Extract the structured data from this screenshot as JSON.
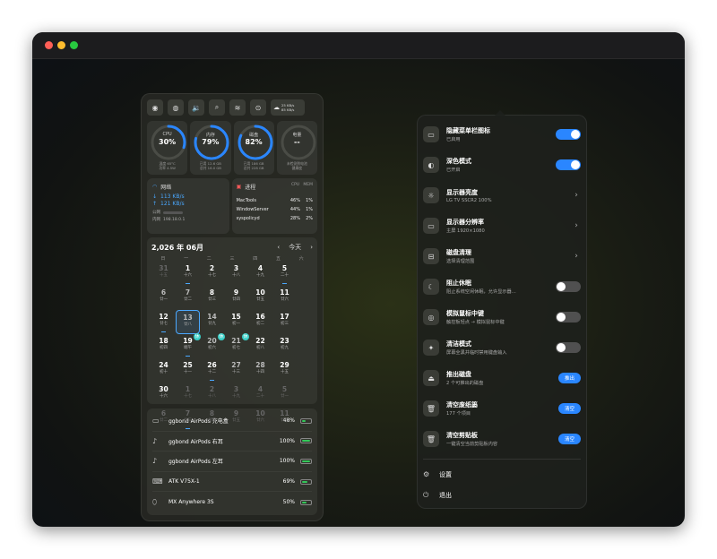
{
  "colors": {
    "accent": "#2a86ff",
    "battery": "#34c759",
    "today": "#4aa8ff",
    "badge": "#3ad0c8"
  },
  "toolbar": {
    "icons": [
      "logo-icon",
      "globe-icon",
      "volume-icon",
      "search-icon",
      "spotify-icon",
      "settings-icon"
    ],
    "net_up": "25 KB/s",
    "net_down": "85 KB/s"
  },
  "gauges": [
    {
      "label": "CPU",
      "value": "30%",
      "percent": 30,
      "foot1": "温度 65°C",
      "foot2": "功率 4.5W"
    },
    {
      "label": "内存",
      "value": "79%",
      "percent": 79,
      "foot1": "已用 12.6 GB",
      "foot2": "总共 16.0 GB"
    },
    {
      "label": "磁盘",
      "value": "82%",
      "percent": 82,
      "foot1": "已用 186 GB",
      "foot2": "总共 228 GB"
    },
    {
      "label": "电量",
      "value": "--",
      "percent": 0,
      "foot1": "未检测到电池",
      "foot2": "健康度"
    }
  ],
  "network": {
    "title": "网络",
    "upload": "113 KB/s",
    "download": "121 KB/s",
    "public_label": "公网",
    "lan_label": "内网",
    "lan_ip": "198.18.0.1"
  },
  "processes": {
    "title": "进程",
    "col_cpu": "CPU",
    "col_mem": "MEM",
    "rows": [
      {
        "name": "MacTools",
        "cpu": "46%",
        "mem": "1%"
      },
      {
        "name": "WindowServer",
        "cpu": "44%",
        "mem": "1%"
      },
      {
        "name": "syspolicyd",
        "cpu": "28%",
        "mem": "2%"
      }
    ]
  },
  "calendar": {
    "title": "2,026 年 06月",
    "today_label": "今天",
    "weekdays": [
      "日",
      "一",
      "二",
      "三",
      "四",
      "五",
      "六"
    ],
    "days": [
      {
        "d": "31",
        "l": "十五",
        "dim": true
      },
      {
        "d": "1",
        "l": "十六",
        "dot": true
      },
      {
        "d": "2",
        "l": "十七"
      },
      {
        "d": "3",
        "l": "十八"
      },
      {
        "d": "4",
        "l": "十九"
      },
      {
        "d": "5",
        "l": "二十",
        "dot": true
      },
      {
        "d": "6",
        "l": "廿一"
      },
      {
        "d": "7",
        "l": "廿二"
      },
      {
        "d": "8",
        "l": "廿三"
      },
      {
        "d": "9",
        "l": "廿四"
      },
      {
        "d": "10",
        "l": "廿五"
      },
      {
        "d": "11",
        "l": "廿六"
      },
      {
        "d": "12",
        "l": "廿七",
        "dot": true
      },
      {
        "d": "13",
        "l": "廿八",
        "today": true
      },
      {
        "d": "14",
        "l": "廿九"
      },
      {
        "d": "15",
        "l": "初一"
      },
      {
        "d": "16",
        "l": "初二"
      },
      {
        "d": "17",
        "l": "初三"
      },
      {
        "d": "18",
        "l": "初四"
      },
      {
        "d": "19",
        "l": "端午",
        "dot": true,
        "badge": "休"
      },
      {
        "d": "20",
        "l": "初六",
        "badge": "休"
      },
      {
        "d": "21",
        "l": "初七",
        "badge": "休"
      },
      {
        "d": "22",
        "l": "初八"
      },
      {
        "d": "23",
        "l": "初九"
      },
      {
        "d": "24",
        "l": "初十"
      },
      {
        "d": "25",
        "l": "十一"
      },
      {
        "d": "26",
        "l": "十二",
        "dot": true
      },
      {
        "d": "27",
        "l": "十三"
      },
      {
        "d": "28",
        "l": "十四"
      },
      {
        "d": "29",
        "l": "十五"
      },
      {
        "d": "30",
        "l": "十六"
      },
      {
        "d": "1",
        "l": "十七",
        "dim": true
      },
      {
        "d": "2",
        "l": "十八",
        "dim": true
      },
      {
        "d": "3",
        "l": "十九",
        "dim": true
      },
      {
        "d": "4",
        "l": "二十",
        "dim": true
      },
      {
        "d": "5",
        "l": "廿一",
        "dim": true
      },
      {
        "d": "6",
        "l": "廿二",
        "dim": true
      },
      {
        "d": "7",
        "l": "廿三",
        "dim": true,
        "dot": true
      },
      {
        "d": "8",
        "l": "廿四",
        "dim": true
      },
      {
        "d": "9",
        "l": "廿五",
        "dim": true
      },
      {
        "d": "10",
        "l": "廿六",
        "dim": true
      },
      {
        "d": "11",
        "l": "廿七",
        "dim": true
      }
    ]
  },
  "devices": [
    {
      "icon": "airpods-case-icon",
      "glyph": "▭",
      "name": "ggbond AirPods 充电盒",
      "pct": "48%",
      "level": 0.48
    },
    {
      "icon": "airpod-right-icon",
      "glyph": "♪",
      "name": "ggbond AirPods 右耳",
      "pct": "100%",
      "level": 1.0
    },
    {
      "icon": "airpod-left-icon",
      "glyph": "♪",
      "name": "ggbond AirPods 左耳",
      "pct": "100%",
      "level": 1.0
    },
    {
      "icon": "keyboard-icon",
      "glyph": "⌨",
      "name": "ATK V75X-1",
      "pct": "69%",
      "level": 0.69
    },
    {
      "icon": "mouse-icon",
      "glyph": "⬯",
      "name": "MX Anywhere 3S",
      "pct": "50%",
      "level": 0.5
    }
  ],
  "menu": {
    "items": [
      {
        "id": "hide-menubar-icons",
        "icon": "menubar-icon",
        "glyph": "▭",
        "title": "隐藏菜单栏图标",
        "sub": "已启用",
        "control": "toggle",
        "on": true
      },
      {
        "id": "dark-mode",
        "icon": "contrast-icon",
        "glyph": "◐",
        "title": "深色模式",
        "sub": "已开启",
        "control": "toggle",
        "on": true
      },
      {
        "id": "display-brightness",
        "icon": "sun-icon",
        "glyph": "☼",
        "title": "显示器亮度",
        "sub": "LG TV SSCR2 100%",
        "control": "chevron"
      },
      {
        "id": "display-resolution",
        "icon": "monitor-icon",
        "glyph": "▭",
        "title": "显示器分辨率",
        "sub": "主屏 1920×1080",
        "control": "chevron"
      },
      {
        "id": "disk-cleanup",
        "icon": "drive-icon",
        "glyph": "⊟",
        "title": "磁盘清理",
        "sub": "选择清理范围",
        "control": "chevron"
      },
      {
        "id": "prevent-sleep",
        "icon": "moon-icon",
        "glyph": "☾",
        "title": "阻止休眠",
        "sub": "阻止系统空闲休眠，允许显示器…",
        "control": "toggle",
        "on": false
      },
      {
        "id": "middle-click",
        "icon": "mouse-click-icon",
        "glyph": "◎",
        "title": "模拟鼠标中键",
        "sub": "触控板轻点 → 模拟鼠标中键",
        "control": "toggle",
        "on": false
      },
      {
        "id": "clean-mode",
        "icon": "sparkle-icon",
        "glyph": "✦",
        "title": "清洁模式",
        "sub": "屏幕全黑并临时禁用键盘输入",
        "control": "toggle",
        "on": false
      },
      {
        "id": "eject-disk",
        "icon": "eject-icon",
        "glyph": "⏏",
        "title": "推出磁盘",
        "sub": "2 个可推出的磁盘",
        "control": "button",
        "button": "推出"
      },
      {
        "id": "empty-trash",
        "icon": "trash-icon",
        "glyph": "🗑",
        "title": "清空废纸篓",
        "sub": "177 个项目",
        "control": "button",
        "button": "清空"
      },
      {
        "id": "clear-clipboard",
        "icon": "clipboard-trash-icon",
        "glyph": "🗑",
        "title": "清空剪贴板",
        "sub": "一键清空当前剪贴板内容",
        "control": "button",
        "button": "清空"
      }
    ],
    "settings_label": "设置",
    "quit_label": "退出"
  }
}
